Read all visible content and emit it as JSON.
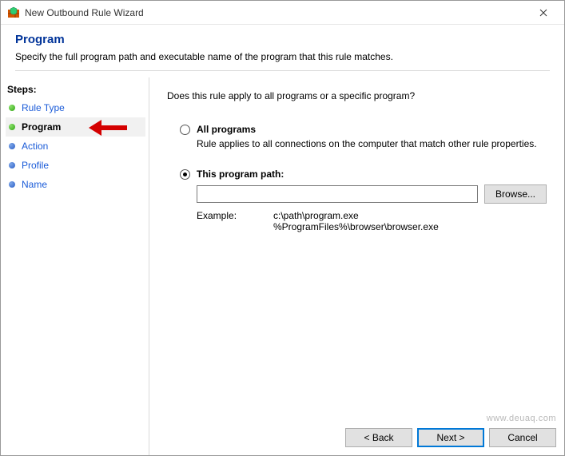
{
  "window": {
    "title": "New Outbound Rule Wizard"
  },
  "header": {
    "title": "Program",
    "subtitle": "Specify the full program path and executable name of the program that this rule matches."
  },
  "sidebar": {
    "heading": "Steps:",
    "items": [
      {
        "label": "Rule Type",
        "state": "done"
      },
      {
        "label": "Program",
        "state": "current"
      },
      {
        "label": "Action",
        "state": "pending"
      },
      {
        "label": "Profile",
        "state": "pending"
      },
      {
        "label": "Name",
        "state": "pending"
      }
    ]
  },
  "main": {
    "question": "Does this rule apply to all programs or a specific program?",
    "option_all": {
      "label": "All programs",
      "description": "Rule applies to all connections on the computer that match other rule properties.",
      "selected": false
    },
    "option_path": {
      "label": "This program path:",
      "selected": true,
      "value": "",
      "browse_label": "Browse...",
      "example_label": "Example:",
      "example_line1": "c:\\path\\program.exe",
      "example_line2": "%ProgramFiles%\\browser\\browser.exe"
    }
  },
  "footer": {
    "back": "< Back",
    "next": "Next >",
    "cancel": "Cancel"
  },
  "watermark": "www.deuaq.com"
}
